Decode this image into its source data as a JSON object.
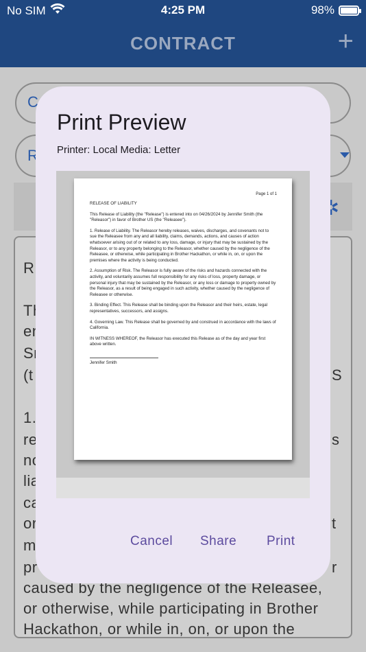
{
  "status_bar": {
    "carrier": "No SIM",
    "time": "4:25 PM",
    "battery": "98%",
    "battery_level": 0.98
  },
  "app_bar": {
    "title": "CONTRACT",
    "add_icon": "plus-icon"
  },
  "background": {
    "field1_initial": "C",
    "field2_initial": "R",
    "doc_lines": [
      "RE",
      "Th",
      "en",
      "Sn",
      "(t",
      "1.",
      "re",
      "no",
      "lia",
      "ca",
      "or",
      "m",
      "pr",
      "caused by the negligence of the Releasee,",
      "or otherwise, while participating in Brother",
      "Hackathon, or while in, on, or upon the"
    ],
    "right_fragments": [
      "S",
      "s",
      "t",
      "r"
    ]
  },
  "dialog": {
    "title": "Print Preview",
    "printer_info": "Printer: Local  Media: Letter",
    "page_label": "Page 1 of 1",
    "document": {
      "heading": "RELEASE OF LIABILITY",
      "paragraphs": [
        "This Release of Liability (the \"Release\") is entered into on 04/26/2024 by Jennifer Smith (the \"Releasor\") in favor of Brother US (the \"Releasee\").",
        "1. Release of Liability. The Releasor hereby releases, waives, discharges, and covenants not to sue the Releasee from any and all liability, claims, demands, actions, and causes of action whatsoever arising out of or related to any loss, damage, or injury that may be sustained by the Releasor, or to any property belonging to the Releasor, whether caused by the negligence of the Releasee, or otherwise, while participating in Brother Hackathon, or while in, on, or upon the premises where the activity is being conducted.",
        "2. Assumption of Risk. The Releasor is fully aware of the risks and hazards connected with the activity, and voluntarily assumes full responsibility for any risks of loss, property damage, or personal injury that may be sustained by the Releasor, or any loss or damage to property owned by the Releasor, as a result of being engaged in such activity, whether caused by the negligence of Releasee or otherwise.",
        "3. Binding Effect. This Release shall be binding upon the Releasor and their heirs, estate, legal representatives, successors, and assigns.",
        "4. Governing Law. This Release shall be governed by and construed in accordance with the laws of California.",
        "IN WITNESS WHEREOF, the Releasor has executed this Release as of the day and year first above written."
      ],
      "signatory": "Jennifer Smith"
    },
    "actions": {
      "cancel": "Cancel",
      "share": "Share",
      "print": "Print"
    }
  }
}
